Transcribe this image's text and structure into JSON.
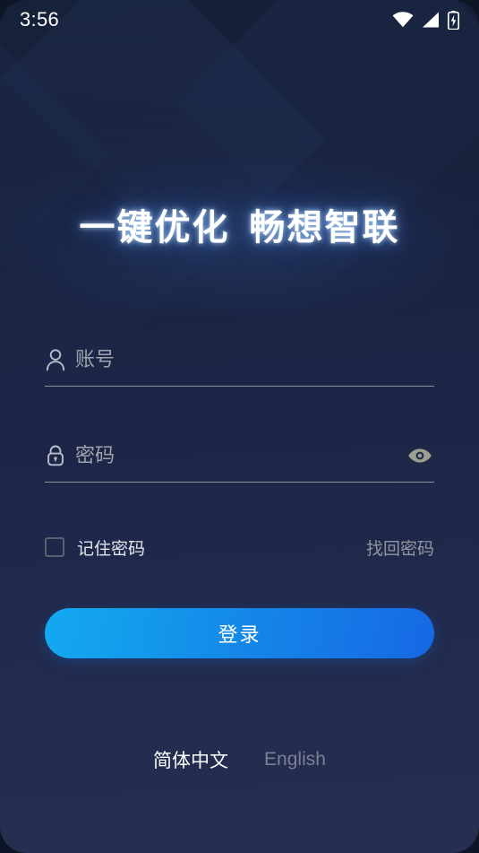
{
  "theme": {
    "bg_top": "#121a2e",
    "bg_bottom": "#262e52",
    "accent_start": "#14a9f2",
    "accent_end": "#1668e4",
    "placeholder": "#a0a3ad",
    "divider": "#8d8f9a",
    "muted_text": "#9296a3"
  },
  "status_bar": {
    "time": "3:56",
    "icons": [
      "wifi-icon",
      "cellular-signal-icon",
      "battery-charging-icon"
    ]
  },
  "branding": {
    "slogan_part1": "一键优化",
    "slogan_part2": "畅想智联"
  },
  "form": {
    "account": {
      "icon": "person-icon",
      "placeholder": "账号",
      "value": ""
    },
    "password": {
      "icon": "lock-icon",
      "placeholder": "密码",
      "value": "",
      "toggle_icon": "eye-icon"
    }
  },
  "options": {
    "remember_label": "记住密码",
    "remember_checked": false,
    "forgot_label": "找回密码"
  },
  "actions": {
    "login_label": "登录"
  },
  "language": {
    "active": "简体中文",
    "inactive": "English"
  }
}
